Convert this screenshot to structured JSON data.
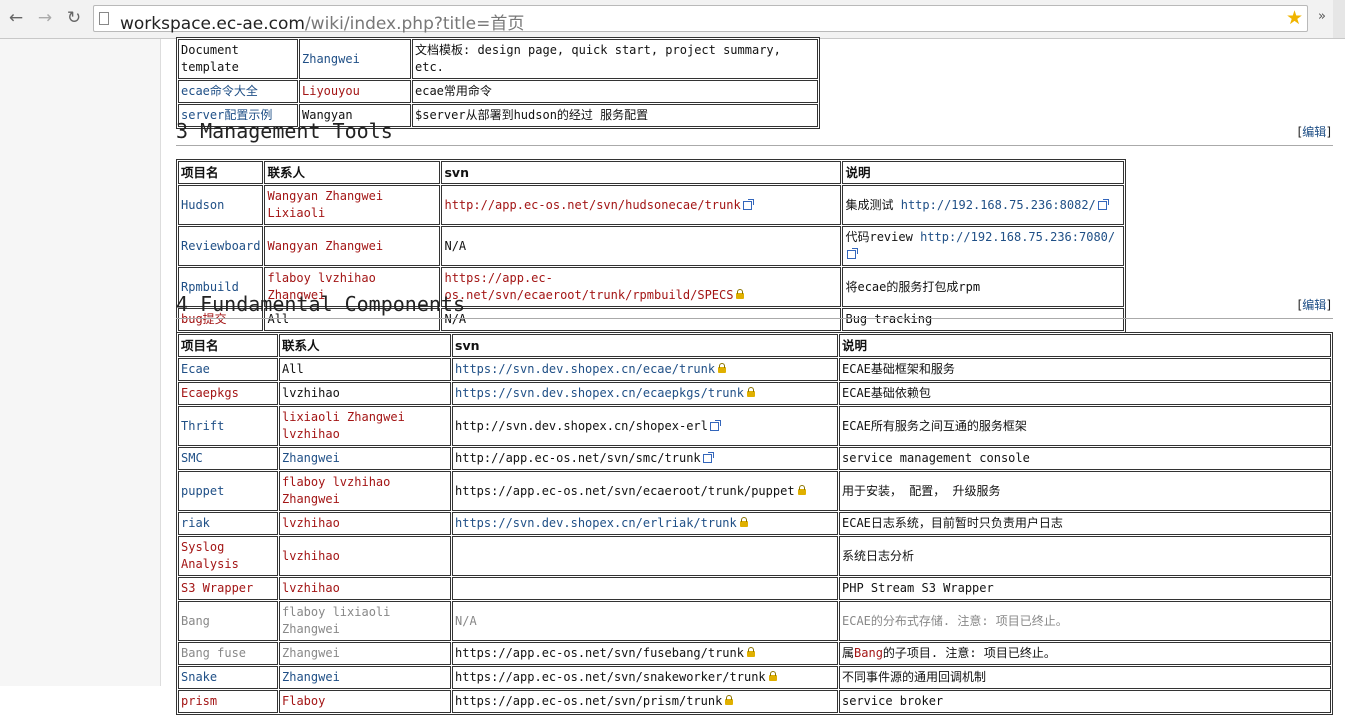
{
  "browser": {
    "url_host": "workspace.ec-ae.com",
    "url_rest": "/wiki/index.php?title=首页",
    "back_icon": "back-arrow-icon",
    "forward_icon": "forward-arrow-icon",
    "reload_icon": "reload-icon",
    "more_label": "»"
  },
  "top_table": {
    "rows": [
      {
        "name": "Document template",
        "contact": "Zhangwei",
        "desc": "文档模板: design page, quick start, project summary, etc."
      },
      {
        "name": "ecae命令大全",
        "contact": "Liyouyou",
        "desc": "ecae常用命令"
      },
      {
        "name": "server配置示例",
        "contact": "Wangyan",
        "desc": "$server从部署到hudson的经过 服务配置"
      }
    ]
  },
  "section3": {
    "title": "3 Management Tools",
    "edit_label": "编辑",
    "headers": [
      "项目名",
      "联系人",
      "svn",
      "说明"
    ],
    "rows": [
      {
        "name": "Hudson",
        "contact": "Wangyan Zhangwei Lixiaoli",
        "svn": "http://app.ec-os.net/svn/hudsonecae/trunk",
        "desc_text": "集成测试 ",
        "desc_link": "http://192.168.75.236:8082/"
      },
      {
        "name": "Reviewboard",
        "contact": "Wangyan Zhangwei",
        "svn": "N/A",
        "desc_text": "代码review ",
        "desc_link": "http://192.168.75.236:7080/"
      },
      {
        "name": "Rpmbuild",
        "contact": "flaboy lvzhihao Zhangwei",
        "svn": "https://app.ec-os.net/svn/ecaeroot/trunk/rpmbuild/SPECS",
        "desc_text": "将ecae的服务打包成rpm",
        "desc_link": ""
      },
      {
        "name": "bug提交",
        "contact": "All",
        "svn": "N/A",
        "desc_text": "Bug tracking",
        "desc_link": ""
      }
    ]
  },
  "section4": {
    "title": "4 Fundamental Components",
    "edit_label": "编辑",
    "headers": [
      "项目名",
      "联系人",
      "svn",
      "说明"
    ],
    "rows": [
      {
        "name": "Ecae",
        "contact": "All",
        "svn": "https://svn.dev.shopex.cn/ecae/trunk",
        "desc": "ECAE基础框架和服务"
      },
      {
        "name": "Ecaepkgs",
        "contact": "lvzhihao",
        "svn": "https://svn.dev.shopex.cn/ecaepkgs/trunk",
        "desc": "ECAE基础依赖包"
      },
      {
        "name": "Thrift",
        "contact": "lixiaoli Zhangwei lvzhihao",
        "svn": "http://svn.dev.shopex.cn/shopex-erl",
        "desc": "ECAE所有服务之间互通的服务框架"
      },
      {
        "name": "SMC",
        "contact": "Zhangwei",
        "svn": "http://app.ec-os.net/svn/smc/trunk",
        "desc": "service management console"
      },
      {
        "name": "puppet",
        "contact": "flaboy lvzhihao Zhangwei",
        "svn": "https://app.ec-os.net/svn/ecaeroot/trunk/puppet",
        "desc": "用于安装， 配置， 升级服务"
      },
      {
        "name": "riak",
        "contact": "lvzhihao",
        "svn": "https://svn.dev.shopex.cn/erlriak/trunk",
        "desc": "ECAE日志系统，目前暂时只负责用户日志"
      },
      {
        "name": "Syslog Analysis",
        "contact": "lvzhihao",
        "svn": "",
        "desc": "系统日志分析"
      },
      {
        "name": "S3 Wrapper",
        "contact": "lvzhihao",
        "svn": "",
        "desc": "PHP Stream S3 Wrapper"
      },
      {
        "name": "Bang",
        "contact": "flaboy lixiaoli Zhangwei",
        "svn": "N/A",
        "desc": "ECAE的分布式存储. 注意: 项目已终止。"
      },
      {
        "name": "Bang fuse",
        "contact": "Zhangwei",
        "svn": "https://app.ec-os.net/svn/fusebang/trunk",
        "desc_a": "属",
        "desc_b": "Bang",
        "desc_c": "的子项目. 注意: 项目已终止。"
      },
      {
        "name": "Snake",
        "contact": "Zhangwei",
        "svn": "https://app.ec-os.net/svn/snakeworker/trunk",
        "desc": "不同事件源的通用回调机制"
      },
      {
        "name": "prism",
        "contact": "Flaboy",
        "svn": "https://app.ec-os.net/svn/prism/trunk",
        "desc": "service broker"
      }
    ]
  },
  "colors": {
    "link": "#1f4f86",
    "redlink": "#a31515",
    "disabled": "#888888"
  }
}
